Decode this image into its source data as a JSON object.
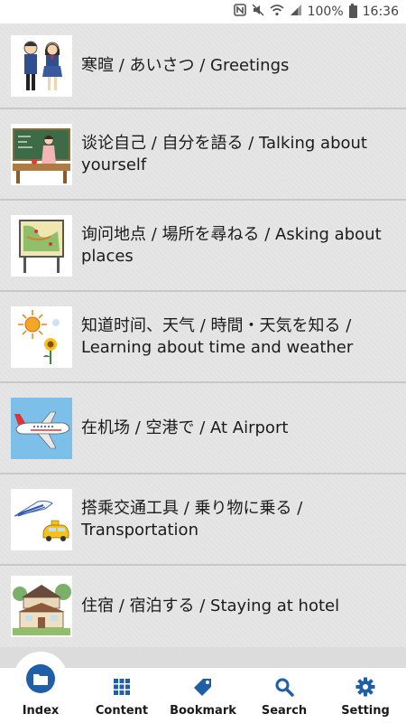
{
  "status_bar": {
    "battery_text": "100%",
    "time": "16:36",
    "icons": [
      "nfc-icon",
      "mute-icon",
      "wifi-icon",
      "signal-icon",
      "battery-icon"
    ]
  },
  "lessons": [
    {
      "label": "寒暄 / あいさつ / Greetings",
      "thumb": "students-illustration"
    },
    {
      "label": "谈论自己 / 自分を語る / Talking about yourself",
      "thumb": "teacher-illustration"
    },
    {
      "label": "询问地点 / 場所を尋ねる / Asking about places",
      "thumb": "map-board-illustration"
    },
    {
      "label": "知道时间、天气 / 時間・天気を知る / Learning about time and weather",
      "thumb": "sun-flower-illustration"
    },
    {
      "label": "在机场 / 空港で / At Airport",
      "thumb": "airplane-illustration"
    },
    {
      "label": "搭乘交通工具 / 乗り物に乗る / Transportation",
      "thumb": "train-taxi-illustration"
    },
    {
      "label": "住宿 / 宿泊する / Staying at hotel",
      "thumb": "hotel-illustration"
    }
  ],
  "nav": {
    "index": "Index",
    "content": "Content",
    "bookmark": "Bookmark",
    "search": "Search",
    "setting": "Setting",
    "accent": "#1e5fa8"
  }
}
